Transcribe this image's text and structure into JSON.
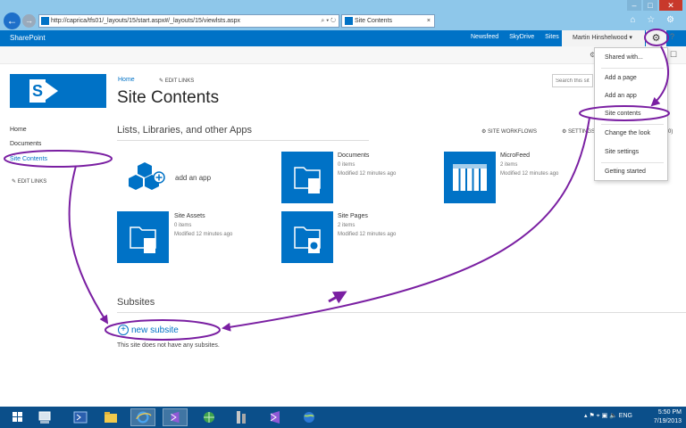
{
  "browser": {
    "url": "http://caprica/tfs01/_layouts/15/start.aspx#/_layouts/15/viewlsts.aspx",
    "url_actions": "⌕ ▾ ↻",
    "tab_title": "Site Contents",
    "tab_close": "×",
    "back_glyph": "←",
    "forward_glyph": "→",
    "window_controls": [
      "–",
      "□",
      "✕"
    ],
    "toolbar_icons": "⌂ ☆ ⚙"
  },
  "suite_bar": {
    "brand": "SharePoint",
    "links": [
      "Newsfeed",
      "SkyDrive",
      "Sites"
    ],
    "user": "Martin Hinshelwood ▾",
    "gear_glyph": "⚙",
    "help_glyph": "?"
  },
  "ribbon": {
    "icon_left": "⚙",
    "icon_right": "☐"
  },
  "header": {
    "logo_letter": "S",
    "home_link": "Home",
    "edit_links": "✎ EDIT LINKS",
    "title": "Site Contents",
    "search_placeholder": "Search this sit"
  },
  "quick_launch": {
    "items": [
      "Home",
      "Documents",
      "Site Contents"
    ],
    "edit_links": "✎ EDIT LINKS"
  },
  "lists_section": {
    "title": "Lists, Libraries, and other Apps",
    "site_workflows": "⚙ SITE WORKFLOWS",
    "settings": "⚙ SETTINGS",
    "count_partial": "(0)"
  },
  "apps": {
    "add_app": "add an app",
    "documents": {
      "name": "Documents",
      "items": "0 items",
      "modified": "Modified 12 minutes ago"
    },
    "microfeed": {
      "name": "MicroFeed",
      "items": "2 items",
      "modified": "Modified 12 minutes ago"
    },
    "site_assets": {
      "name": "Site Assets",
      "items": "0 items",
      "modified": "Modified 12 minutes ago"
    },
    "site_pages": {
      "name": "Site Pages",
      "items": "2 items",
      "modified": "Modified 12 minutes ago"
    }
  },
  "subsites": {
    "title": "Subsites",
    "new_subsite": "new subsite",
    "plus_glyph": "+",
    "empty_message": "This site does not have any subsites."
  },
  "gear_menu": {
    "items": [
      "Shared with...",
      "Add a page",
      "Add an app",
      "Site contents",
      "Change the look",
      "Site settings",
      "Getting started"
    ]
  },
  "taskbar": {
    "tray": "▴ ⚑ ⌖ ▣ 🔈   ENG",
    "time": "5:50 PM",
    "date": "7/19/2013"
  },
  "colors": {
    "suite_blue": "#0072c6",
    "annotation_purple": "#7a1fa2",
    "taskbar": "#0b4f8a"
  }
}
